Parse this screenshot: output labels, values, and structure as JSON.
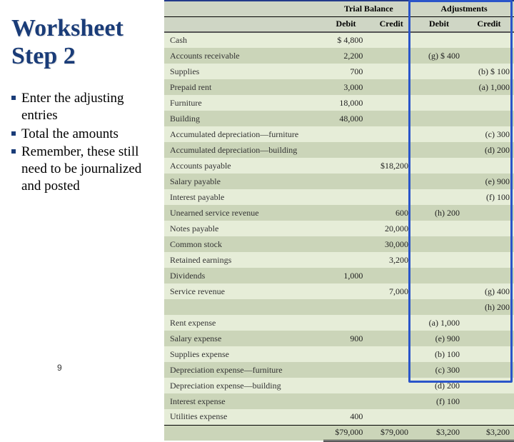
{
  "title_line1": "Worksheet",
  "title_line2": "Step 2",
  "bullets": [
    "Enter  the adjusting entries",
    "Total the amounts",
    "Remember, these still need to be journalized and posted"
  ],
  "page_number": "9",
  "headers": {
    "trial_balance": "Trial Balance",
    "adjustments": "Adjustments",
    "debit": "Debit",
    "credit": "Credit"
  },
  "rows": [
    {
      "name": "Cash",
      "tb_debit": "$ 4,800",
      "tb_credit": "",
      "adj_debit": "",
      "adj_credit": ""
    },
    {
      "name": "Accounts receivable",
      "tb_debit": "2,200",
      "tb_credit": "",
      "adj_debit": "(g) $ 400",
      "adj_credit": ""
    },
    {
      "name": "Supplies",
      "tb_debit": "700",
      "tb_credit": "",
      "adj_debit": "",
      "adj_credit": "(b) $ 100"
    },
    {
      "name": "Prepaid rent",
      "tb_debit": "3,000",
      "tb_credit": "",
      "adj_debit": "",
      "adj_credit": "(a) 1,000"
    },
    {
      "name": "Furniture",
      "tb_debit": "18,000",
      "tb_credit": "",
      "adj_debit": "",
      "adj_credit": ""
    },
    {
      "name": "Building",
      "tb_debit": "48,000",
      "tb_credit": "",
      "adj_debit": "",
      "adj_credit": ""
    },
    {
      "name": "Accumulated depreciation—furniture",
      "tb_debit": "",
      "tb_credit": "",
      "adj_debit": "",
      "adj_credit": "(c) 300"
    },
    {
      "name": "Accumulated depreciation—building",
      "tb_debit": "",
      "tb_credit": "",
      "adj_debit": "",
      "adj_credit": "(d) 200"
    },
    {
      "name": "Accounts payable",
      "tb_debit": "",
      "tb_credit": "$18,200",
      "adj_debit": "",
      "adj_credit": ""
    },
    {
      "name": "Salary payable",
      "tb_debit": "",
      "tb_credit": "",
      "adj_debit": "",
      "adj_credit": "(e) 900"
    },
    {
      "name": "Interest payable",
      "tb_debit": "",
      "tb_credit": "",
      "adj_debit": "",
      "adj_credit": "(f) 100"
    },
    {
      "name": "Unearned service revenue",
      "tb_debit": "",
      "tb_credit": "600",
      "adj_debit": "(h) 200",
      "adj_credit": ""
    },
    {
      "name": "Notes payable",
      "tb_debit": "",
      "tb_credit": "20,000",
      "adj_debit": "",
      "adj_credit": ""
    },
    {
      "name": "Common stock",
      "tb_debit": "",
      "tb_credit": "30,000",
      "adj_debit": "",
      "adj_credit": ""
    },
    {
      "name": "Retained earnings",
      "tb_debit": "",
      "tb_credit": "3,200",
      "adj_debit": "",
      "adj_credit": ""
    },
    {
      "name": "Dividends",
      "tb_debit": "1,000",
      "tb_credit": "",
      "adj_debit": "",
      "adj_credit": ""
    },
    {
      "name": "Service revenue",
      "tb_debit": "",
      "tb_credit": "7,000",
      "adj_debit": "",
      "adj_credit": "(g) 400"
    },
    {
      "name": "",
      "tb_debit": "",
      "tb_credit": "",
      "adj_debit": "",
      "adj_credit": "(h) 200"
    },
    {
      "name": "Rent expense",
      "tb_debit": "",
      "tb_credit": "",
      "adj_debit": "(a) 1,000",
      "adj_credit": ""
    },
    {
      "name": "Salary expense",
      "tb_debit": "900",
      "tb_credit": "",
      "adj_debit": "(e) 900",
      "adj_credit": ""
    },
    {
      "name": "Supplies expense",
      "tb_debit": "",
      "tb_credit": "",
      "adj_debit": "(b) 100",
      "adj_credit": ""
    },
    {
      "name": "Depreciation expense—furniture",
      "tb_debit": "",
      "tb_credit": "",
      "adj_debit": "(c) 300",
      "adj_credit": ""
    },
    {
      "name": "Depreciation expense—building",
      "tb_debit": "",
      "tb_credit": "",
      "adj_debit": "(d) 200",
      "adj_credit": ""
    },
    {
      "name": "Interest expense",
      "tb_debit": "",
      "tb_credit": "",
      "adj_debit": "(f) 100",
      "adj_credit": ""
    },
    {
      "name": "Utilities expense",
      "tb_debit": "400",
      "tb_credit": "",
      "adj_debit": "",
      "adj_credit": ""
    }
  ],
  "totals": {
    "tb_debit": "$79,000",
    "tb_credit": "$79,000",
    "adj_debit": "$3,200",
    "adj_credit": "$3,200"
  }
}
